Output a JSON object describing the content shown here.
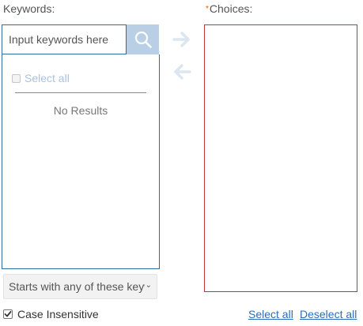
{
  "keywords": {
    "label": "Keywords:",
    "search_placeholder": "Input keywords here",
    "select_all": "Select all",
    "no_results": "No Results"
  },
  "choices": {
    "required_mark": "*",
    "label": "Choices:"
  },
  "match_mode": {
    "selected": "Starts with any of these keywords"
  },
  "options": {
    "case_insensitive_label": "Case Insensitive",
    "case_insensitive_checked": true
  },
  "links": {
    "select_all": "Select all",
    "deselect_all": "Deselect all"
  },
  "icons": {
    "search": "search-icon",
    "add": "arrow-right-icon",
    "remove": "arrow-left-icon"
  },
  "colors": {
    "accent_border": "#2e6da4",
    "search_button_bg": "#b9cfe5",
    "choices_border": "#c0392b",
    "link": "#2a6ebb",
    "required": "#e05a00"
  }
}
